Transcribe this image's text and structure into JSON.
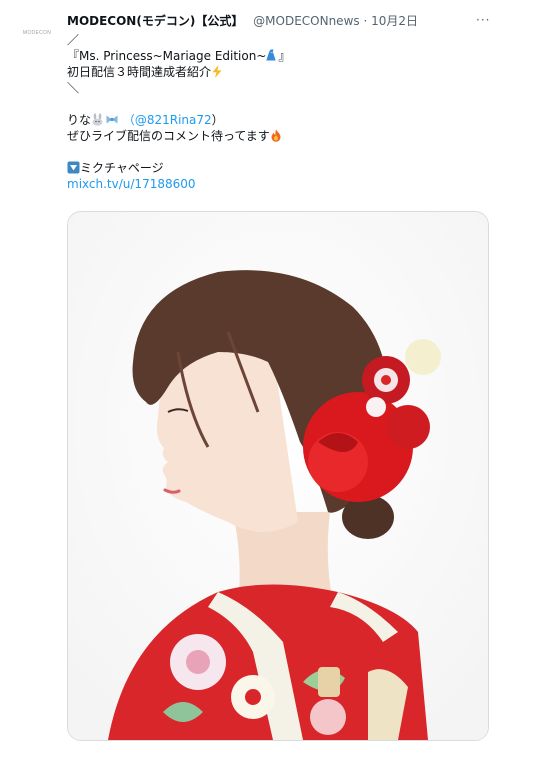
{
  "tweet": {
    "avatar_text": "MODECON",
    "author_name": "MODECON(モデコン)【公式】",
    "handle_and_date": "@MODECONnews · 10月2日",
    "more_label": "···",
    "lines": {
      "slash_open": "／",
      "title": "『Ms. Princess~Mariage Edition~",
      "title_close": "』",
      "line3": "初日配信３時間達成者紹介",
      "slash_close": "＼",
      "name_prefix": "りな",
      "mention_open": "（",
      "mention": "@821Rina72",
      "mention_close": "）",
      "line6": "ぜひライブ配信のコメント待ってます",
      "link_label": "ミクチャページ",
      "url": "mixch.tv/u/17188600"
    },
    "icons": {
      "dress": "dress-icon",
      "lightning": "lightning-icon",
      "rabbit": "rabbit-icon",
      "ribbon": "ribbon-icon",
      "fire": "fire-icon",
      "down_triangle": "down-triangle-icon"
    },
    "media": {
      "description_icon": "photo"
    }
  },
  "colors": {
    "link": "#1d9bf0",
    "text": "#0f1419",
    "secondary": "#536471",
    "kimono_red": "#d8262a"
  }
}
